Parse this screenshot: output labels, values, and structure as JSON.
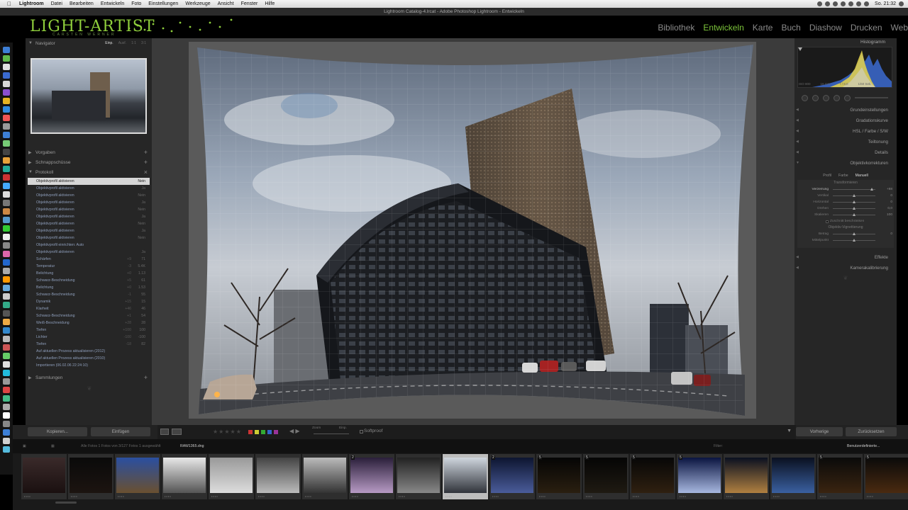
{
  "menubar": {
    "app_name": "Lightroom",
    "items": [
      "Datei",
      "Bearbeiten",
      "Entwickeln",
      "Foto",
      "Einstellungen",
      "Werkzeuge",
      "Ansicht",
      "Fenster",
      "Hilfe"
    ],
    "clock": "So. 21:32"
  },
  "window": {
    "title": "Lightroom Catalog-4.lrcat - Adobe Photoshop Lightroom - Entwickeln"
  },
  "header": {
    "logo": "LIGHT-ARTIST",
    "logo_sub": "CARSTEN WERNER",
    "modules": [
      "Bibliothek",
      "Entwickeln",
      "Karte",
      "Buch",
      "Diashow",
      "Drucken",
      "Web"
    ],
    "active_module": "Entwickeln",
    "accent_color": "#7cc43a"
  },
  "left_panel": {
    "navigator": {
      "title": "Navigator",
      "zoom_options": [
        "Einp.",
        "Ausf.",
        "1:1",
        "3:1"
      ],
      "selected_zoom": "Einp."
    },
    "sections": [
      "Vorgaben",
      "Schnappschüsse",
      "Protokoll"
    ],
    "history": [
      {
        "label": "Objektivprofil aktivieren",
        "v1": "",
        "v2": "Nein"
      },
      {
        "label": "Objektivprofil aktivieren",
        "v1": "",
        "v2": "Ja"
      },
      {
        "label": "Objektivprofil aktivieren",
        "v1": "",
        "v2": "Nein"
      },
      {
        "label": "Objektivprofil aktivieren",
        "v1": "",
        "v2": "Ja"
      },
      {
        "label": "Objektivprofil aktivieren",
        "v1": "",
        "v2": "Nein"
      },
      {
        "label": "Objektivprofil aktivieren",
        "v1": "",
        "v2": "Ja"
      },
      {
        "label": "Objektivprofil aktivieren",
        "v1": "",
        "v2": "Nein"
      },
      {
        "label": "Objektivprofil aktivieren",
        "v1": "",
        "v2": "Ja"
      },
      {
        "label": "Objektivprofil aktivieren",
        "v1": "",
        "v2": "Nein"
      },
      {
        "label": "Objektivprofil einrichten: Auto",
        "v1": "",
        "v2": ""
      },
      {
        "label": "Objektivprofil aktivieren",
        "v1": "",
        "v2": "Ja"
      },
      {
        "label": "Schärfen",
        "v1": "+9",
        "v2": "71"
      },
      {
        "label": "Temperatur",
        "v1": "-3",
        "v2": "5.4K"
      },
      {
        "label": "Belichtung",
        "v1": "+0",
        "v2": "1.13"
      },
      {
        "label": "Schwarz-Beschneidung",
        "v1": "+5",
        "v2": "61"
      },
      {
        "label": "Belichtung",
        "v1": "+0",
        "v2": "1.53"
      },
      {
        "label": "Schwarz-Beschneidung",
        "v1": "-1",
        "v2": "55"
      },
      {
        "label": "Dynamik",
        "v1": "+15",
        "v2": "15"
      },
      {
        "label": "Klarheit",
        "v1": "+46",
        "v2": "46"
      },
      {
        "label": "Schwarz-Beschneidung",
        "v1": "+1",
        "v2": "54"
      },
      {
        "label": "Weiß-Beschneidung",
        "v1": "+28",
        "v2": "28"
      },
      {
        "label": "Tiefen",
        "v1": "+100",
        "v2": "100"
      },
      {
        "label": "Lichter",
        "v1": "-100",
        "v2": "-100"
      },
      {
        "label": "Tiefen",
        "v1": "-18",
        "v2": "82"
      },
      {
        "label": "Auf aktuellen Prozess aktualisieren (2012)",
        "v1": "",
        "v2": ""
      },
      {
        "label": "Auf aktuellen Prozess aktualisieren (2010)",
        "v1": "",
        "v2": ""
      },
      {
        "label": "Importieren (06.02.06 22:24:10)",
        "v1": "",
        "v2": ""
      }
    ],
    "collections": "Sammlungen"
  },
  "right_panel": {
    "histogram_title": "Histogramm",
    "histogram_info": [
      "ISO 800",
      "16 mm",
      "f / 8,0",
      "1/60 Sek."
    ],
    "sections_top": [
      "Grundeinstellungen",
      "Gradationskurve",
      "HSL / Farbe / S/W",
      "Teiltonung",
      "Details",
      "Objektivkorrekturen"
    ],
    "lens_tabs": [
      "Profil",
      "Farbe",
      "Manuell"
    ],
    "active_lens_tab": "Manuell",
    "transform_title": "Transformieren",
    "sliders": [
      {
        "label": "Verzerrung",
        "value": "+88",
        "pos": 0.92,
        "highlight": true
      },
      {
        "label": "Vertikal",
        "value": "0",
        "pos": 0.5
      },
      {
        "label": "Horizontal",
        "value": "0",
        "pos": 0.5
      },
      {
        "label": "Drehen",
        "value": "0,0",
        "pos": 0.5
      },
      {
        "label": "Skalieren",
        "value": "100",
        "pos": 0.5
      }
    ],
    "crop_checkbox": "Zuschnitt beschränken",
    "vignette_title": "Objektiv-Vignettierung",
    "vignette_sliders": [
      {
        "label": "Betrag",
        "value": "0",
        "pos": 0.5
      },
      {
        "label": "Mittelpunkt",
        "value": "",
        "pos": 0.5
      }
    ],
    "sections_bottom": [
      "Effekte",
      "Kamerakalibrierung"
    ]
  },
  "bottom": {
    "copy_btn": "Kopieren...",
    "paste_btn": "Einfügen",
    "zoom_label": "Zoom",
    "zoom_value": "Einp.",
    "softproof": "Softproof",
    "prev_btn": "Vorherige",
    "reset_btn": "Zurücksetzen"
  },
  "filmbar": {
    "info": "Alle Fotos  1 Fotos von 3/127 Fotos  1 ausgewählt",
    "filename": "RAW1365.dng",
    "filter_label": "Filter:",
    "filter_value": "Benutzerdefinierte..."
  },
  "filmstrip_badges": [
    "",
    "",
    "",
    "",
    "",
    "",
    "",
    "2",
    "",
    "",
    "2",
    "5",
    "5",
    "5",
    "5",
    "",
    "",
    "5",
    "5"
  ]
}
